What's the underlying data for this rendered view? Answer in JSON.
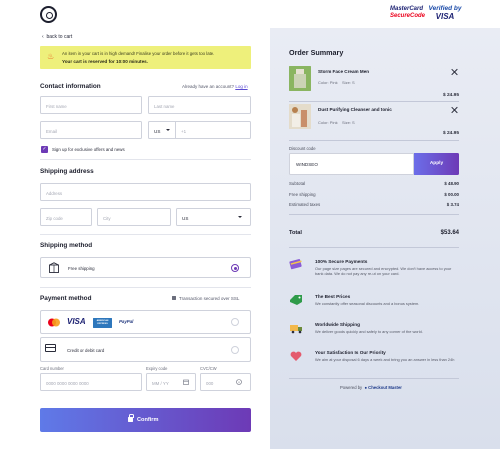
{
  "header": {
    "mastercard_line1": "MasterCard",
    "mastercard_line2": "SecureCode",
    "visa_line1": "Verified by",
    "visa_line2": "VISA"
  },
  "checkout": {
    "back_label": "back to cart",
    "alert": {
      "line1": "An item in your cart is in high demand! Finalise your order before it gets too late.",
      "line2": "Your cart is reserved for 10:00 minutes."
    },
    "contact": {
      "title": "Contact information",
      "have_account": "Already have an account?",
      "login_label": "Log in",
      "first_name_placeholder": "First name",
      "last_name_placeholder": "Last name",
      "email_placeholder": "Email",
      "phone_country": "US",
      "phone_prefix": "+1",
      "newsletter_label": "Sign up for exclusive offers and news",
      "newsletter_checked": true
    },
    "shipping_address": {
      "title": "Shipping address",
      "address_placeholder": "Address",
      "zip_placeholder": "Zip code",
      "city_placeholder": "City",
      "country_value": "US"
    },
    "shipping_method": {
      "title": "Shipping method",
      "option_label": "Free shipping",
      "selected": true
    },
    "payment": {
      "title": "Payment method",
      "secured_note": "Transaction secured over SSL",
      "card_brands": [
        "VISA",
        "AMERICAN EXPRESS",
        "PayPal"
      ],
      "card_option_label": "Credit or debit card",
      "card_number_label": "Card number",
      "card_number_placeholder": "0000  0000  0000  0000",
      "expiry_label": "Expiry code",
      "expiry_placeholder": "MM / YY",
      "cvc_label": "CVC/CW",
      "cvc_placeholder": "000"
    },
    "confirm_label": "Confirm"
  },
  "order_summary": {
    "title": "Order Summary",
    "items": [
      {
        "name": "Storm Face Cream Men",
        "color": "Color: Pink",
        "size": "Size: S",
        "price": "$ 24.95"
      },
      {
        "name": "Dust Purifying Cleanser and tonic",
        "color": "Color: Pink",
        "size": "Size: S",
        "price": "$ 24.95"
      }
    ],
    "discount_label": "Discount code",
    "discount_value": "WINDSEO",
    "apply_label": "Apply",
    "subtotal_label": "Subtotal",
    "subtotal": "$ 48.90",
    "shipping_label": "Free shipping",
    "shipping": "$ 00.00",
    "taxes_label": "Estimated taxes",
    "taxes": "$ 3.74",
    "total_label": "Total",
    "total": "$53.64",
    "badges": [
      {
        "title": "100% Secure Payments",
        "text": "Our page size pages are secured and encrypted. We don't have access to your bank data. We do not pay any re-ut on your card."
      },
      {
        "title": "The Best Prices",
        "text": "We constantly offer seasonal discounts and a bonus system."
      },
      {
        "title": "Worldwide Shipping",
        "text": "We deliver goods quickly and safely to any corner of the world."
      },
      {
        "title": "Your Satisfaction Is Our Priority",
        "text": "We aim at your disposal 6 days a week and bring you an answer in less than 24h"
      }
    ],
    "powered_prefix": "Powered by",
    "powered_brand": "Checkout Master"
  },
  "colors": {
    "accent": "#6d3ab6",
    "accent_blue": "#5f7ae8",
    "alert_bg": "#eef07b",
    "summary_bg": "#e2e7f1"
  }
}
